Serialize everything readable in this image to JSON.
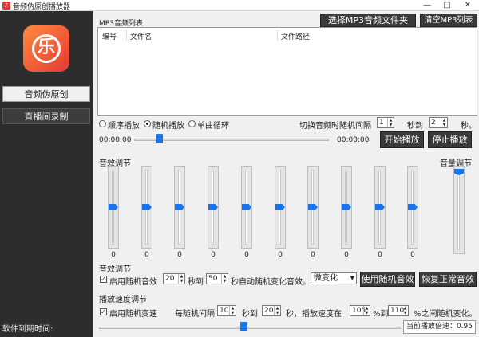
{
  "window": {
    "title": "音频伪原创播放器",
    "minimize": "—",
    "maximize": "□",
    "close": "✕"
  },
  "sidebar": {
    "logo_glyph": "乐",
    "items": [
      {
        "label": "音频伪原创"
      },
      {
        "label": "直播间录制"
      }
    ],
    "expire_label": "软件到期时间:"
  },
  "playlist": {
    "title": "MP3音频列表",
    "select_button": "选择MP3音频文件夹",
    "clear_button": "清空MP3列表",
    "columns": [
      "编号",
      "文件名",
      "文件路径"
    ]
  },
  "play_mode": {
    "options": [
      {
        "label": "顺序播放",
        "selected": false
      },
      {
        "label": "随机播放",
        "selected": true
      },
      {
        "label": "单曲循环",
        "selected": false
      }
    ],
    "interval_label": "切换音频时随机间隔",
    "interval_from": "1",
    "interval_to_label": "秒到",
    "interval_to": "2",
    "interval_unit": "秒。"
  },
  "player": {
    "time_start": "00:00:00",
    "time_end": "00:00:00",
    "progress": 0.13,
    "play_button": "开始播放",
    "stop_button": "停止播放"
  },
  "equalizer": {
    "title": "音效调节",
    "bands": [
      0,
      0,
      0,
      0,
      0,
      0,
      0,
      0,
      0,
      0
    ],
    "volume_label": "音量调节",
    "volume_level": 1.0
  },
  "effect": {
    "title": "音效调节",
    "enable_label": "启用随机音效",
    "enabled": true,
    "from": "20",
    "to_label": "秒到",
    "to": "50",
    "suffix": "秒自动随机变化音效。",
    "mode": "微变化",
    "use_button": "使用随机音效",
    "restore_button": "恢复正常音效"
  },
  "speed": {
    "title": "播放速度调节",
    "enable_label": "启用随机变速",
    "enabled": true,
    "every_label": "每随机间隔",
    "from": "10",
    "to_label": "秒到",
    "to": "20",
    "mid_label": "秒，播放速度在",
    "min": "105",
    "min_to_label": "%到",
    "max": "110",
    "suffix": "%之间随机变化。",
    "rate_label": "当前播放倍速：0.95",
    "slider_position": 0.48
  }
}
